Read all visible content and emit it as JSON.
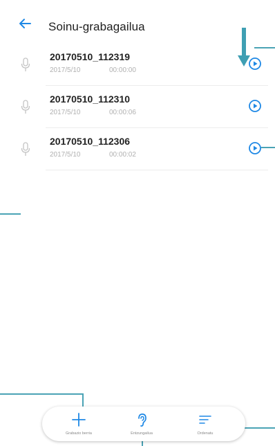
{
  "header": {
    "title": "Soinu-grabagailua",
    "back_icon": "back-arrow-icon"
  },
  "recordings": [
    {
      "name": "20170510_112319",
      "date": "2017/5/10",
      "duration": "00:00:00"
    },
    {
      "name": "20170510_112310",
      "date": "2017/5/10",
      "duration": "00:00:06"
    },
    {
      "name": "20170510_112306",
      "date": "2017/5/10",
      "duration": "00:00:02"
    }
  ],
  "bottom_bar": {
    "new_recording": "Grabazio berria",
    "earpiece": "Entzungailua",
    "sort": "Ordenatu"
  },
  "colors": {
    "accent": "#1e88e5",
    "callout": "#4aa3b5"
  }
}
